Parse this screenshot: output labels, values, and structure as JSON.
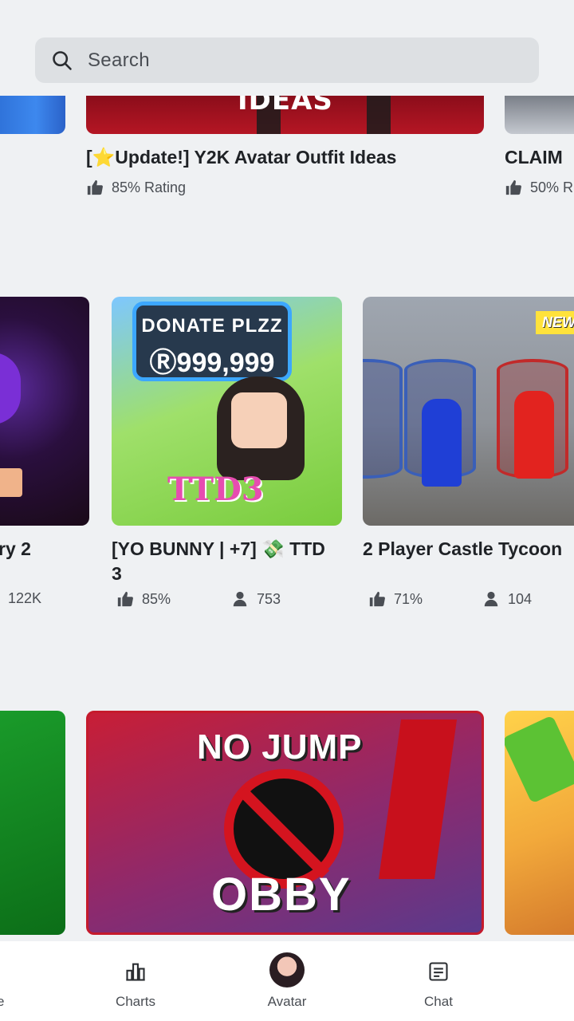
{
  "search": {
    "placeholder": "Search"
  },
  "row1": {
    "banner_text": "IDEAS",
    "mid": {
      "title": "[⭐Update!] Y2K Avatar Outfit Ideas",
      "rating": "85% Rating"
    },
    "right": {
      "title": "CLAIM",
      "rating": "50% R"
    }
  },
  "row2": {
    "left": {
      "title": "ry 2",
      "players": "122K"
    },
    "mid": {
      "sign_line1": "DONATE PLZZ",
      "sign_line2": "Ⓡ999,999",
      "logo_text": "TTD3",
      "title_line1": "[YO BUNNY | +7] 💸 TTD",
      "title_line2": "3",
      "rating": "85%",
      "players": "753"
    },
    "right": {
      "badge": "NEW",
      "title": "2 Player Castle Tycoon",
      "rating": "71%",
      "players": "104"
    }
  },
  "row3": {
    "mid": {
      "line1": "NO JUMP",
      "line2": "OBBY"
    }
  },
  "nav": {
    "home_cut": "e",
    "charts": "Charts",
    "avatar": "Avatar",
    "chat": "Chat"
  },
  "icons": {
    "search": "search-icon",
    "thumb": "thumbs-up-icon",
    "players": "players-icon",
    "charts": "bar-chart-icon",
    "chat": "chat-icon"
  },
  "colors": {
    "background": "#eff1f3",
    "search_bg": "#dde0e3",
    "nav_bg": "#ffffff",
    "text": "#1f2226"
  }
}
